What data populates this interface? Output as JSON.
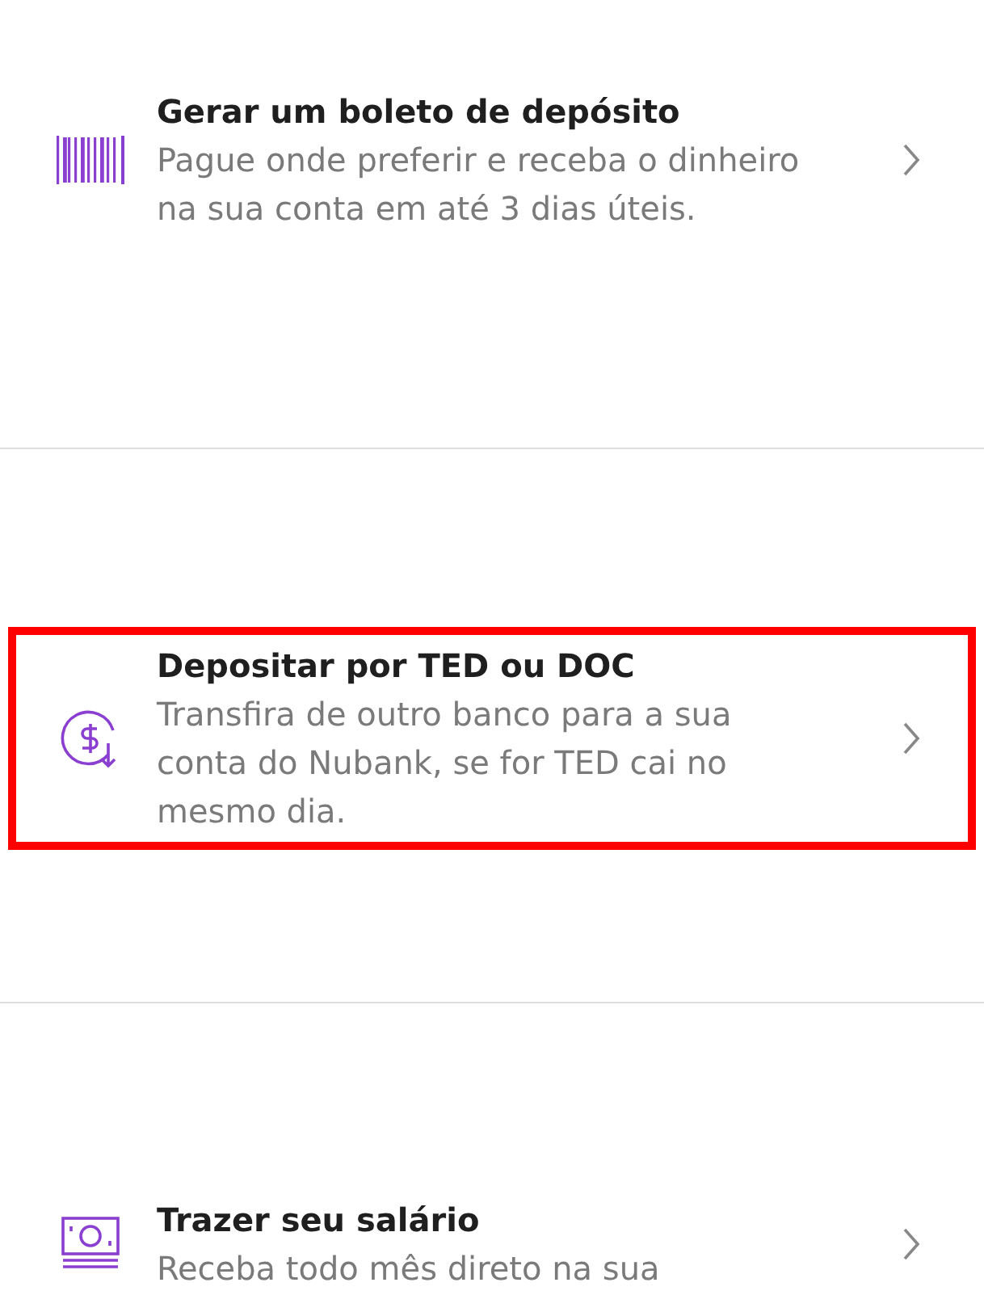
{
  "options": [
    {
      "kind": "barcode",
      "title": "Gerar um boleto de depósito",
      "description": "Pague onde preferir e receba o dinheiro na sua conta em até 3 dias úteis.",
      "highlighted": false
    },
    {
      "kind": "dollar",
      "title": "Depositar por TED ou DOC",
      "description": "Transfira de outro banco para a sua conta do Nubank, se for TED cai no mesmo dia.",
      "highlighted": true
    },
    {
      "kind": "money",
      "title": "Trazer seu salário",
      "description": "Receba todo mês direto na sua",
      "highlighted": false
    }
  ]
}
